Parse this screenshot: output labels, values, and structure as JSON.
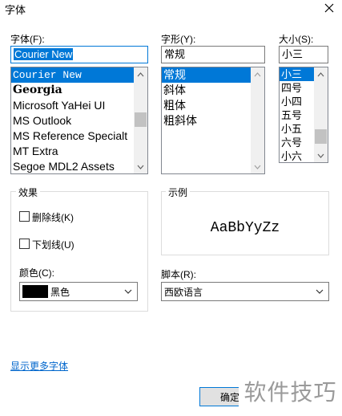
{
  "dialog": {
    "title": "字体"
  },
  "font": {
    "label": "字体(F):",
    "value": "Courier New",
    "items": [
      "Courier New",
      "Georgia",
      "Microsoft YaHei UI",
      "MS Outlook",
      "MS Reference Specialt",
      "MT Extra",
      "Segoe MDL2 Assets"
    ],
    "selected_index": 0
  },
  "style": {
    "label": "字形(Y):",
    "value": "常规",
    "items": [
      "常规",
      "斜体",
      "粗体",
      "粗斜体"
    ],
    "selected_index": 0
  },
  "size": {
    "label": "大小(S):",
    "value": "小三",
    "items": [
      "小三",
      "四号",
      "小四",
      "五号",
      "小五",
      "六号",
      "小六"
    ],
    "selected_index": 0
  },
  "effects": {
    "label": "效果",
    "strikeout": {
      "label": "删除线(K)",
      "checked": false
    },
    "underline": {
      "label": "下划线(U)",
      "checked": false
    },
    "color_label": "颜色(C):",
    "color_value": "黑色",
    "color_hex": "#000000"
  },
  "sample": {
    "label": "示例",
    "text": "AaBbYyZz"
  },
  "script": {
    "label": "脚本(R):",
    "value": "西欧语言"
  },
  "more_fonts_link": "显示更多字体",
  "ok_button": "确定",
  "watermark": "软件技巧",
  "colors": {
    "accent": "#0078d7",
    "link": "#0066cc"
  }
}
